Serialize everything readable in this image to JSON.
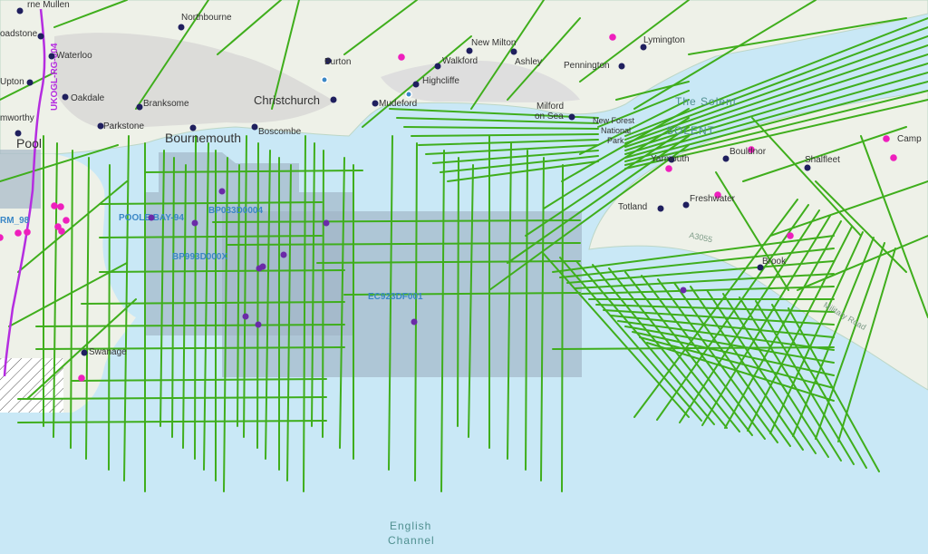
{
  "colors": {
    "water": "#c9e8f6",
    "land": "#eef1e8",
    "urban": "#d9d9d6",
    "survey_line": "#3fae1c",
    "licence_block": "#9fb3c4",
    "point_purple": "#6b2aa8",
    "point_magenta": "#ee1fbd",
    "town_dot": "#1f1f5e",
    "pipeline": "#b52de0",
    "block_label": "#3a87c6",
    "water_label": "#4f8f8f"
  },
  "places": [
    {
      "id": "rne-mullen",
      "name": "rne Mullen"
    },
    {
      "id": "broadstone",
      "name": "oadstone"
    },
    {
      "id": "northbourne",
      "name": "Northbourne"
    },
    {
      "id": "waterloo",
      "name": "Waterloo"
    },
    {
      "id": "upton",
      "name": "Upton"
    },
    {
      "id": "oakdale",
      "name": "Oakdale"
    },
    {
      "id": "branksome",
      "name": "Branksome"
    },
    {
      "id": "parkstone",
      "name": "Parkstone"
    },
    {
      "id": "hamworthy",
      "name": "mworthy"
    },
    {
      "id": "poole",
      "name": "Pool"
    },
    {
      "id": "bournemouth",
      "name": "Bournemouth"
    },
    {
      "id": "boscombe",
      "name": "Boscombe"
    },
    {
      "id": "christchurch",
      "name": "Christchurch"
    },
    {
      "id": "burton",
      "name": "Burton"
    },
    {
      "id": "mudeford",
      "name": "Mudeford"
    },
    {
      "id": "highcliffe",
      "name": "Highcliffe"
    },
    {
      "id": "walkford",
      "name": "Walkford"
    },
    {
      "id": "new-milton",
      "name": "New Milton"
    },
    {
      "id": "ashley",
      "name": "Ashley"
    },
    {
      "id": "pennington",
      "name": "Pennington"
    },
    {
      "id": "lymington",
      "name": "Lymington"
    },
    {
      "id": "milford",
      "name": "Milford"
    },
    {
      "id": "on-sea",
      "name": "on Sea"
    },
    {
      "id": "new-forest-np",
      "name": "New Forest"
    },
    {
      "id": "national",
      "name": "National"
    },
    {
      "id": "park",
      "name": "Park"
    },
    {
      "id": "yarmouth",
      "name": "Yarmouth"
    },
    {
      "id": "bouldnor",
      "name": "Bouldnor"
    },
    {
      "id": "shalfleet",
      "name": "Shalfleet"
    },
    {
      "id": "camp",
      "name": "Camp"
    },
    {
      "id": "freshwater",
      "name": "Freshwater"
    },
    {
      "id": "totland",
      "name": "Totland"
    },
    {
      "id": "brook",
      "name": "Brook"
    },
    {
      "id": "swanage",
      "name": "Swanage"
    }
  ],
  "water_labels": {
    "the_solent_a": "The Solent",
    "the_solent_b": "SOLENT",
    "english": "English",
    "channel": "Channel"
  },
  "block_labels": [
    {
      "id": "bp033d0004",
      "text": "BP033D0004"
    },
    {
      "id": "poole-bay-94",
      "text": "POOLE BAY-94"
    },
    {
      "id": "bp993d000x",
      "text": "BP993D000X"
    },
    {
      "id": "ec923df001",
      "text": "EC923DF001"
    },
    {
      "id": "rm-left",
      "text": "RM_98"
    }
  ],
  "road_labels": {
    "a3055": "A3055",
    "military_road": "Military Road"
  },
  "pipeline_label": "UKOGL-RG-004"
}
